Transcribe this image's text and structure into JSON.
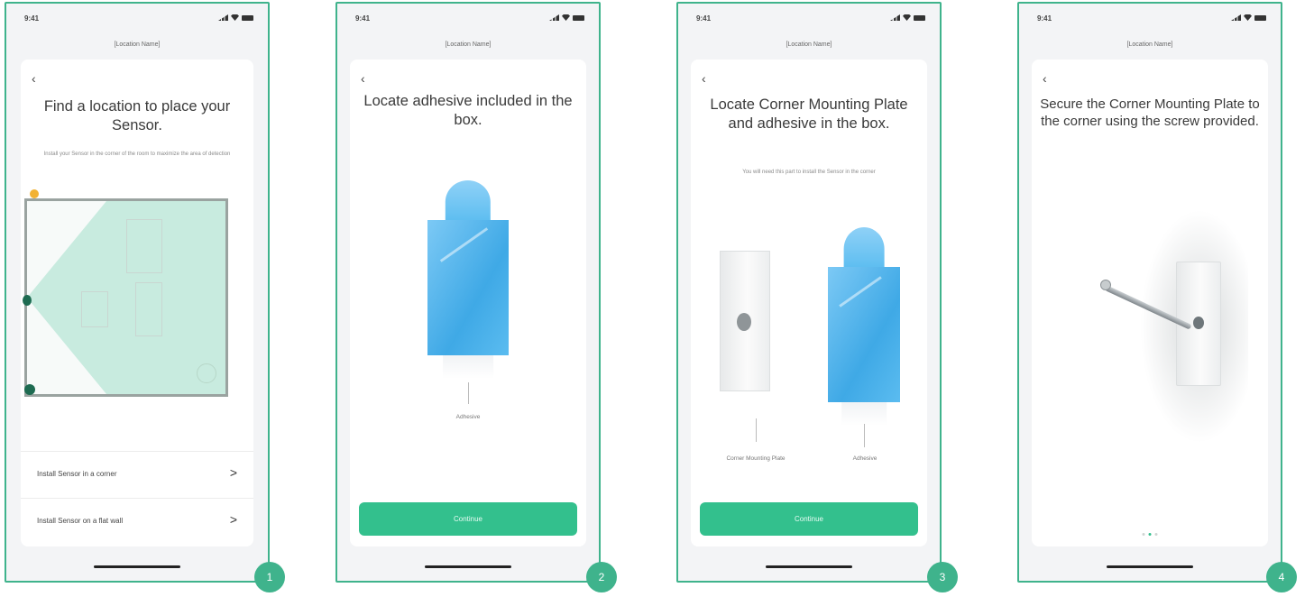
{
  "status": {
    "time": "9:41"
  },
  "location_name": "[Location Name]",
  "screens": [
    {
      "step": "1",
      "title": "Find a location to place your Sensor.",
      "subtitle": "Install your Sensor in the corner of the room to maximize the area of detection",
      "options": [
        {
          "label": "Install Sensor in a corner",
          "chevron": ">"
        },
        {
          "label": "Install Sensor on a flat wall",
          "chevron": ">"
        }
      ]
    },
    {
      "step": "2",
      "title": "Locate adhesive included in the box.",
      "captions": [
        "Adhesive"
      ],
      "button": "Continue"
    },
    {
      "step": "3",
      "title": "Locate Corner Mounting Plate and adhesive in the box.",
      "subtitle": "You will need this part to install the Sensor in the corner",
      "captions": [
        "Corner Mounting Plate",
        "Adhesive"
      ],
      "button": "Continue"
    },
    {
      "step": "4",
      "title": "Secure the Corner Mounting Plate to the corner using the screw provided.",
      "pager": {
        "pages": 3,
        "active": 2
      }
    }
  ],
  "colors": {
    "accent": "#3fb38c",
    "button": "#33c08d",
    "adhesive": "#4db7ee"
  },
  "icons": [
    "back-chevron-icon",
    "chevron-right-icon",
    "signal-icon",
    "wifi-icon",
    "battery-icon"
  ]
}
